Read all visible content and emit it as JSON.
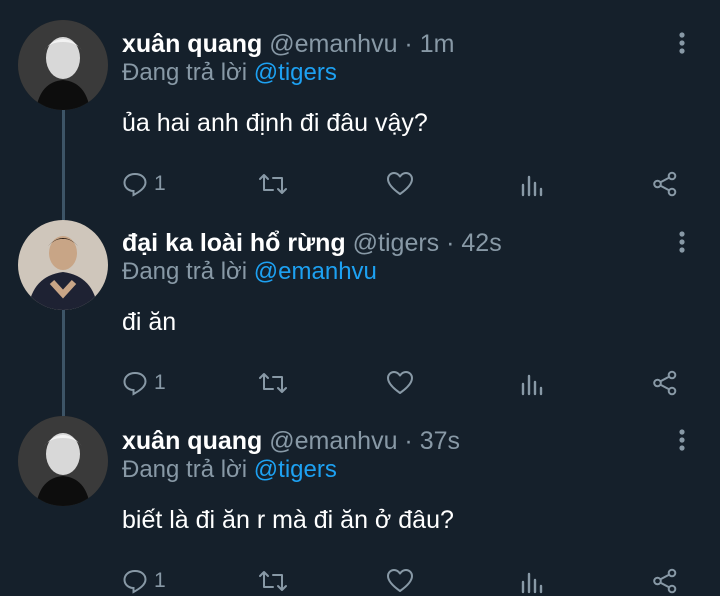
{
  "reply_prefix": "Đang trả lời",
  "tweets": [
    {
      "name": "xuân quang",
      "handle": "@emanhvu · 1m",
      "reply_to": "@tigers",
      "text": "ủa hai anh định đi đâu vậy?",
      "reply_count": "1"
    },
    {
      "name": "đại ka loài hổ rừng",
      "handle": "@tigers · 42s",
      "reply_to": "@emanhvu",
      "text": "đi ăn",
      "reply_count": "1"
    },
    {
      "name": "xuân quang",
      "handle": "@emanhvu · 37s",
      "reply_to": "@tigers",
      "text": "biết là đi ăn r mà đi ăn ở đâu?",
      "reply_count": "1"
    }
  ],
  "icons": {
    "reply": "reply-icon",
    "retweet": "retweet-icon",
    "like": "heart-icon",
    "analytics": "analytics-icon",
    "share": "share-icon",
    "more": "more-vertical-icon"
  },
  "colors": {
    "background": "#15202b",
    "secondary_text": "#8899a6",
    "mention": "#1da1f2",
    "thread_line": "#3d5466"
  }
}
